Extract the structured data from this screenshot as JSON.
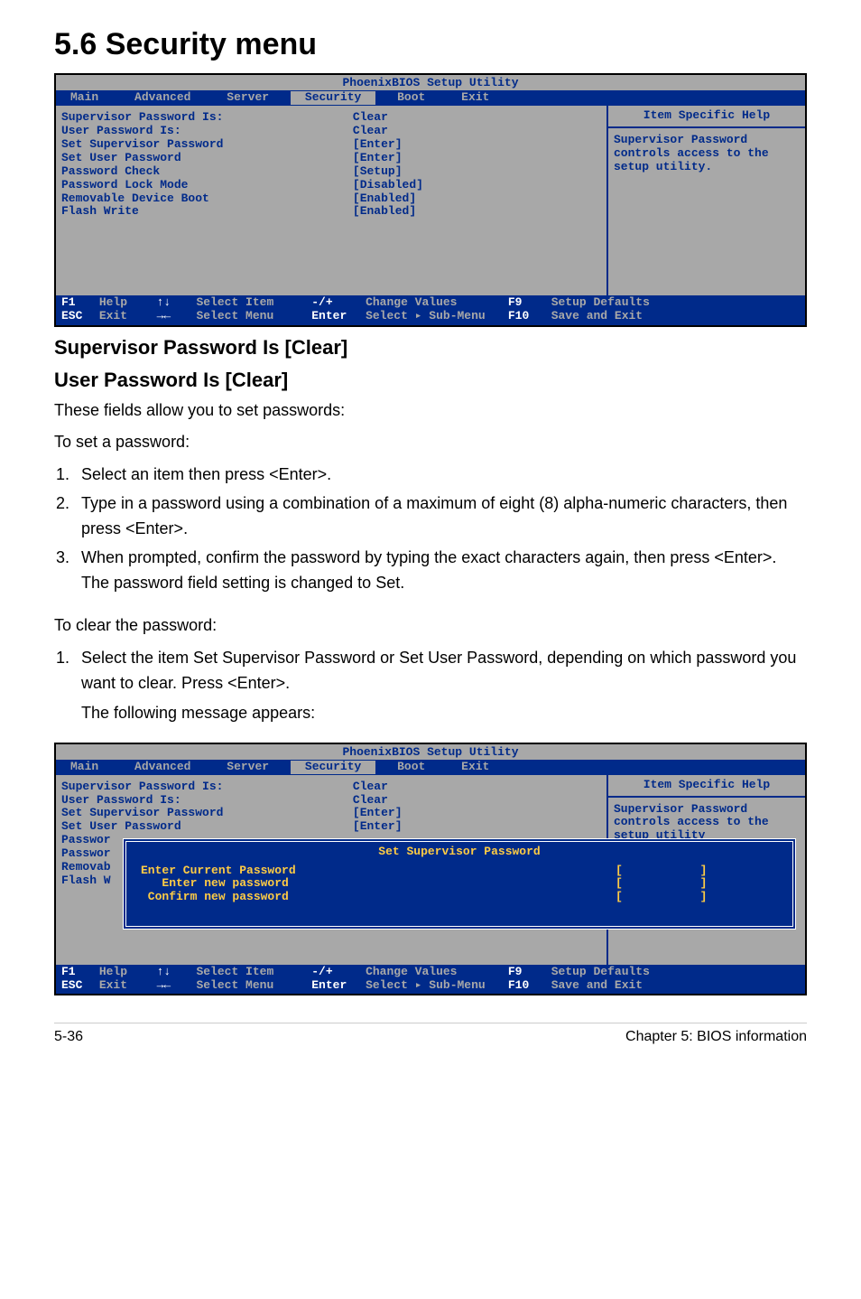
{
  "page": {
    "heading": "5.6 Security menu",
    "h2a": "Supervisor Password Is [Clear]",
    "h2b": "User Password Is [Clear]",
    "intro1": "These fields allow you to set passwords:",
    "intro2": "To set a password:",
    "steps_set": [
      "Select an item then press <Enter>.",
      "Type in a password using a combination of a maximum of eight (8) alpha-numeric characters, then press <Enter>.",
      "When prompted, confirm the password by typing the exact characters again, then press <Enter>. The password field setting is changed to Set."
    ],
    "intro3": "To clear the password:",
    "steps_clear": [
      "Select the item Set Supervisor Password or Set User Password, depending on which password you want to clear. Press <Enter>."
    ],
    "appears": "The following message appears:",
    "footer_left": "5-36",
    "footer_right": "Chapter 5: BIOS information"
  },
  "bios": {
    "title": "PhoenixBIOS Setup Utility",
    "tabs": [
      "Main",
      "Advanced",
      "Server",
      "Security",
      "Boot",
      "Exit"
    ],
    "active_tab": "Security",
    "items": [
      {
        "label": "Supervisor Password Is:",
        "value": "Clear"
      },
      {
        "label": "User Password Is:",
        "value": "Clear"
      },
      {
        "label": "",
        "value": ""
      },
      {
        "label": "Set Supervisor Password",
        "value": "[Enter]"
      },
      {
        "label": "Set User Password",
        "value": "[Enter]"
      },
      {
        "label": "Password Check",
        "value": "[Setup]"
      },
      {
        "label": "Password Lock Mode",
        "value": "[Disabled]"
      },
      {
        "label": "Removable Device Boot",
        "value": "[Enabled]"
      },
      {
        "label": "Flash Write",
        "value": "[Enabled]"
      }
    ],
    "help_title": "Item Specific Help",
    "help_text": "Supervisor Password controls access to the setup utility.",
    "footer": {
      "f1": "F1",
      "help": "Help",
      "updown": "↑↓",
      "selitem": "Select Item",
      "pm": "-/+",
      "chval": "Change Values",
      "f9": "F9",
      "setdef": "Setup Defaults",
      "esc": "ESC",
      "exit": "Exit",
      "lr": "→←",
      "selmenu": "Select Menu",
      "enter": "Enter",
      "selsub": "Select ▸ Sub-Menu",
      "f10": "F10",
      "save": "Save and Exit"
    }
  },
  "bios2": {
    "items_short": [
      {
        "label": "Supervisor Password Is:",
        "value": "Clear"
      },
      {
        "label": "User Password Is:",
        "value": "Clear"
      },
      {
        "label": "",
        "value": ""
      },
      {
        "label": "Set Supervisor Password",
        "value": "[Enter]"
      },
      {
        "label": "Set User Password",
        "value": "[Enter]"
      }
    ],
    "trunc": [
      "Passwor",
      "Passwor",
      "Removab",
      "Flash W"
    ],
    "help_text2": "Supervisor Password controls access to the setup utility",
    "popup": {
      "title": "Set Supervisor Password",
      "lines": [
        {
          "label": "Enter Current Password",
          "field": "[           ]"
        },
        {
          "label": "   Enter new password",
          "field": "[           ]"
        },
        {
          "label": " Confirm new password",
          "field": "[           ]"
        }
      ]
    }
  }
}
